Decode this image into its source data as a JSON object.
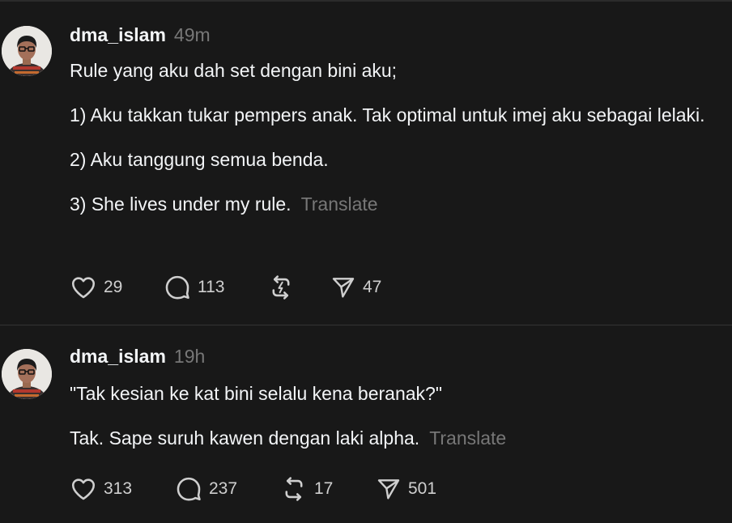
{
  "colors": {
    "background": "#181818",
    "text_primary": "#f3f5f7",
    "text_secondary": "#777777",
    "icon": "#cfcfcf",
    "divider": "#333333"
  },
  "posts": [
    {
      "username": "dma_islam",
      "timestamp": "49m",
      "paragraphs": [
        "Rule yang aku dah set dengan bini aku;",
        "1) Aku takkan tukar pempers anak. Tak optimal untuk imej aku sebagai lelaki.",
        "2) Aku tanggung semua benda."
      ],
      "last_paragraph": "3) She lives under my rule.",
      "translate_label": "Translate",
      "actions": {
        "like_icon": "heart-icon",
        "like_count": "29",
        "reply_icon": "comment-bubble-icon",
        "reply_count": "113",
        "repost_icon": "repost-icon",
        "repost_count": "",
        "share_icon": "send-icon",
        "share_count": "47"
      }
    },
    {
      "username": "dma_islam",
      "timestamp": "19h",
      "paragraphs": [
        "\"Tak kesian ke kat bini selalu kena beranak?\""
      ],
      "last_paragraph": "Tak. Sape suruh kawen dengan laki alpha.",
      "translate_label": "Translate",
      "actions": {
        "like_icon": "heart-icon",
        "like_count": "313",
        "reply_icon": "comment-bubble-icon",
        "reply_count": "237",
        "repost_icon": "repost-icon",
        "repost_count": "17",
        "share_icon": "send-icon",
        "share_count": "501"
      }
    }
  ]
}
